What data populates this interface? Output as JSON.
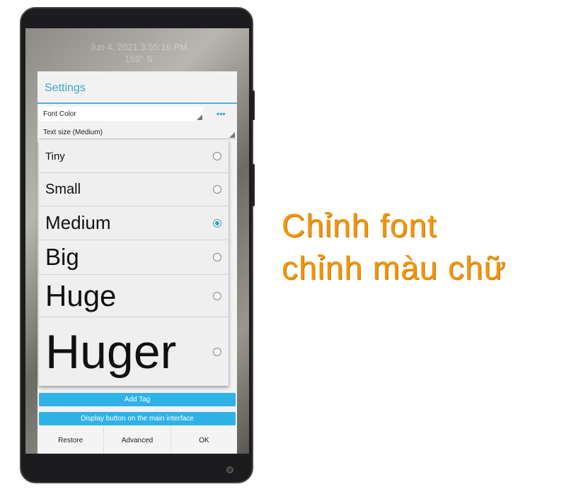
{
  "background_overlay": {
    "line1": "Jun 4, 2021 3:55:16 PM",
    "line2": "159° S"
  },
  "dialog": {
    "title": "Settings",
    "font_color_label": "Font Color",
    "more_icon": "more-dots-icon",
    "text_size_label": "Text size (Medium)"
  },
  "size_options": [
    {
      "label": "Tiny",
      "selected": false
    },
    {
      "label": "Small",
      "selected": false
    },
    {
      "label": "Medium",
      "selected": true
    },
    {
      "label": "Big",
      "selected": false
    },
    {
      "label": "Huge",
      "selected": false
    },
    {
      "label": "Huger",
      "selected": false
    }
  ],
  "buttons": {
    "add_tag": "Add Tag",
    "display_button": "Display button on the main interface",
    "restore": "Restore",
    "advanced": "Advanced",
    "ok": "OK"
  },
  "caption": {
    "line1": "Chỉnh font",
    "line2": "chỉnh màu chữ"
  },
  "colors": {
    "accent": "#3aa6cf",
    "button_blue": "#2fb2e6",
    "caption": "#f0950f"
  }
}
